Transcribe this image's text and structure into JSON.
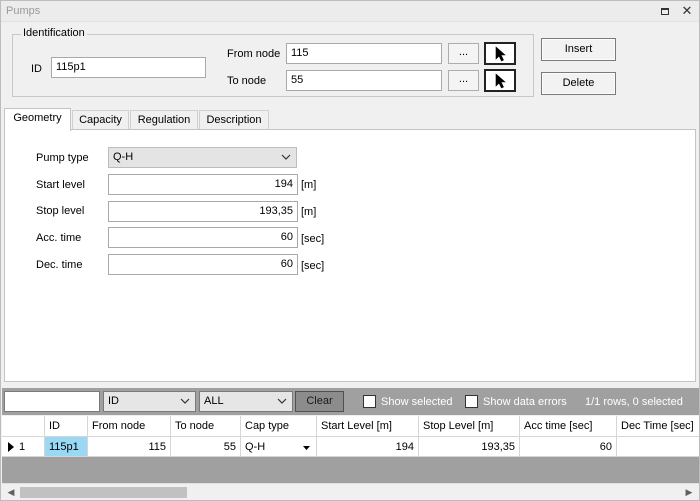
{
  "window": {
    "title": "Pumps"
  },
  "identification": {
    "legend": "Identification",
    "id_label": "ID",
    "id_value": "115p1",
    "from_node_label": "From node",
    "from_node_value": "115",
    "to_node_label": "To node",
    "to_node_value": "55",
    "browse_label": "...",
    "cursor_icon": "pointer-cursor-icon"
  },
  "actions": {
    "insert_label": "Insert",
    "delete_label": "Delete"
  },
  "tabs": [
    {
      "label": "Geometry",
      "active": true
    },
    {
      "label": "Capacity",
      "active": false
    },
    {
      "label": "Regulation",
      "active": false
    },
    {
      "label": "Description",
      "active": false
    }
  ],
  "geometry": {
    "pump_type_label": "Pump type",
    "pump_type_value": "Q-H",
    "fields": [
      {
        "label": "Start level",
        "value": "194",
        "unit": "[m]"
      },
      {
        "label": "Stop level",
        "value": "193,35",
        "unit": "[m]"
      },
      {
        "label": "Acc. time",
        "value": "60",
        "unit": "[sec]"
      },
      {
        "label": "Dec. time",
        "value": "60",
        "unit": "[sec]"
      }
    ]
  },
  "filter": {
    "search_value": "",
    "field_value": "ID",
    "scope_value": "ALL",
    "clear_label": "Clear",
    "show_selected_label": "Show selected",
    "show_errors_label": "Show data errors",
    "status": "1/1 rows, 0 selected"
  },
  "grid": {
    "columns": [
      "ID",
      "From node",
      "To node",
      "Cap type",
      "Start Level [m]",
      "Stop Level [m]",
      "Acc time [sec]",
      "Dec Time [sec]"
    ],
    "rows": [
      {
        "index": "1",
        "id": "115p1",
        "from_node": "115",
        "to_node": "55",
        "cap_type": "Q-H",
        "start_level": "194",
        "stop_level": "193,35",
        "acc_time": "60",
        "dec_time": ""
      }
    ]
  },
  "colors": {
    "selected_cell": "#99d9f5",
    "filter_bar": "#a0a0a0"
  }
}
